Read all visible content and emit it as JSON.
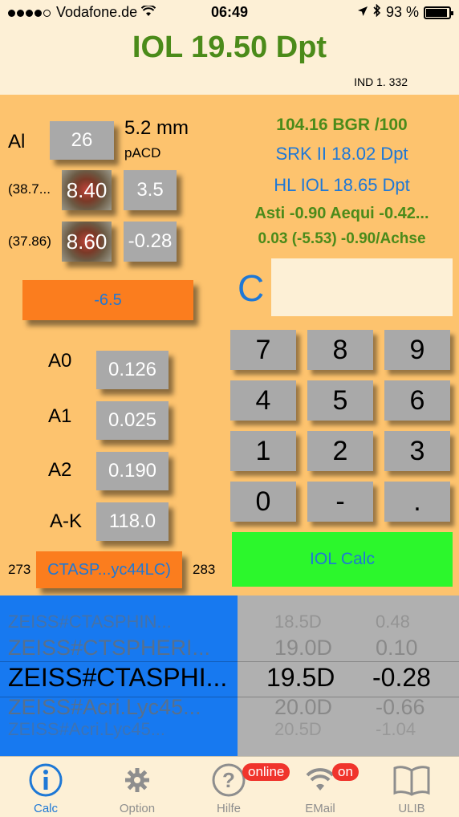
{
  "status": {
    "carrier": "Vodafone.de",
    "time": "06:49",
    "battery": "93 %",
    "battery_level": 0.93
  },
  "header": {
    "title": "IOL 19.50 Dpt",
    "ind": "IND 1. 332"
  },
  "left": {
    "al_label": "Al",
    "al_value": "26",
    "mm": "5.2 mm",
    "pacd": "pACD",
    "k1_note": "(38.7...",
    "k1_value": "8.40",
    "k1_side": "3.5",
    "k2_note": "(37.86)",
    "k2_value": "8.60",
    "k2_side": "-0.28",
    "target": "-6.5",
    "a0_label": "A0",
    "a0_value": "0.126",
    "a1_label": "A1",
    "a1_value": "0.025",
    "a2_label": "A2",
    "a2_value": "0.190",
    "ak_label": "A-K",
    "ak_value": "118.0",
    "lens_left": "273",
    "lens_name": "CTASP...yc44LC)",
    "lens_right": "283"
  },
  "results": {
    "bgr": "104.16 BGR /100",
    "srk": "SRK II 18.02 Dpt",
    "hl": "HL IOL 18.65 Dpt",
    "asti": "Asti -0.90  Aequi -0.42...",
    "axis": "0.03 (-5.53) -0.90/Achse"
  },
  "keypad": {
    "clear": "C",
    "display": "",
    "keys": [
      "7",
      "8",
      "9",
      "4",
      "5",
      "6",
      "1",
      "2",
      "3",
      "0",
      "-",
      "."
    ],
    "calc": "IOL Calc"
  },
  "picker": {
    "lenses": [
      "ZEISS#CTASPHIN...",
      "ZEISS#CTSPHERI...",
      "ZEISS#CTASPHI...",
      "ZEISS#Acri.Lyc45...",
      "ZEISS#Acri.Lyc45..."
    ],
    "powers": [
      "18.5D",
      "19.0D",
      "19.5D",
      "20.0D",
      "20.5D"
    ],
    "refr": [
      "0.48",
      "0.10",
      "-0.28",
      "-0.66",
      "-1.04"
    ]
  },
  "tabs": {
    "calc": "Calc",
    "option": "Option",
    "hilfe": "Hilfe",
    "email": "EMail",
    "ulib": "ULIB",
    "online_badge": "online",
    "on_badge": "on"
  },
  "colors": {
    "accent_green": "#4b8b1a",
    "accent_blue": "#1e78d6",
    "orange": "#fb7d1e",
    "calc_green": "#2cf72c"
  }
}
